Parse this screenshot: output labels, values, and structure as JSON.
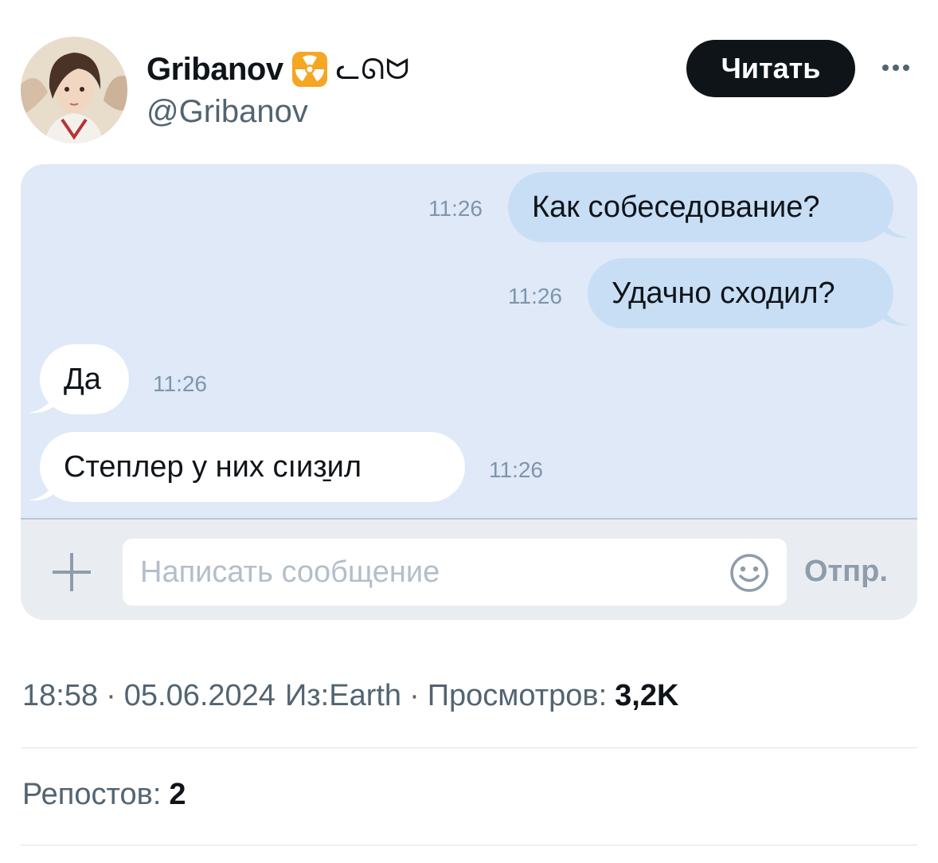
{
  "tweet": {
    "author": {
      "display_name": "Gribanov",
      "name_glyphs": "ᓚᘏᗢ",
      "handle": "@Gribanov",
      "avatar": "anime-character-avatar",
      "name_emoji": "radioactive-icon"
    },
    "follow_label": "Читать",
    "more_icon": "more-dots-icon"
  },
  "chat": {
    "messages": [
      {
        "direction": "out",
        "text": "Как собеседование?",
        "time": "11:26"
      },
      {
        "direction": "out",
        "text": "Удачно сходил?",
        "time": "11:26"
      },
      {
        "direction": "in",
        "text": "Да",
        "time": "11:26"
      },
      {
        "direction": "in",
        "text": "Степлер у них сıиз̱ил",
        "time": "11:26"
      }
    ],
    "input": {
      "placeholder": "Написать сообщение",
      "value": ""
    },
    "send_label": "Отпр.",
    "add_icon": "plus-icon",
    "emoji_icon": "smiley-icon",
    "colors": {
      "outgoing_bubble": "#c8def5",
      "incoming_bubble": "#ffffff",
      "chat_background": "#dfe9f7"
    }
  },
  "meta": {
    "time": "18:58",
    "separator": "·",
    "date": "05.06.2024",
    "source": "Из:Earth",
    "views_label": "Просмотров:",
    "views_count": "3,2K"
  },
  "stats": {
    "reposts_label": "Репостов:",
    "reposts_count": "2"
  }
}
